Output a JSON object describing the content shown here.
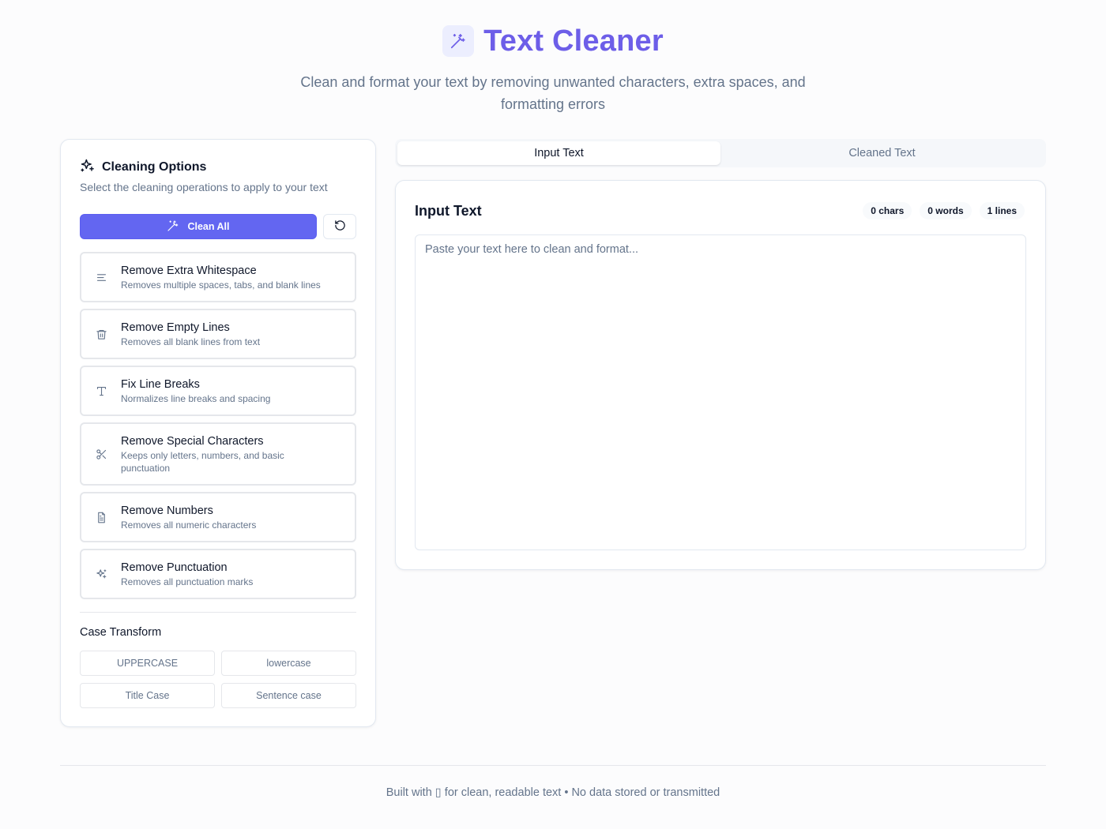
{
  "header": {
    "title": "Text Cleaner",
    "subtitle": "Clean and format your text by removing unwanted characters, extra spaces, and formatting errors",
    "logo_icon": "magic-wand-icon"
  },
  "options_panel": {
    "title": "Cleaning Options",
    "subtitle": "Select the cleaning operations to apply to your text",
    "clean_all_label": "Clean All",
    "reset_icon": "rotate-ccw-icon",
    "options": [
      {
        "name": "Remove Extra Whitespace",
        "desc": "Removes multiple spaces, tabs, and blank lines",
        "icon": "align-left-icon"
      },
      {
        "name": "Remove Empty Lines",
        "desc": "Removes all blank lines from text",
        "icon": "trash-icon"
      },
      {
        "name": "Fix Line Breaks",
        "desc": "Normalizes line breaks and spacing",
        "icon": "type-icon"
      },
      {
        "name": "Remove Special Characters",
        "desc": "Keeps only letters, numbers, and basic punctuation",
        "icon": "scissors-icon"
      },
      {
        "name": "Remove Numbers",
        "desc": "Removes all numeric characters",
        "icon": "file-text-icon"
      },
      {
        "name": "Remove Punctuation",
        "desc": "Removes all punctuation marks",
        "icon": "sparkles-icon"
      }
    ],
    "case_transform": {
      "title": "Case Transform",
      "buttons": [
        "UPPERCASE",
        "lowercase",
        "Title Case",
        "Sentence case"
      ]
    }
  },
  "tabs": [
    {
      "label": "Input Text",
      "active": true
    },
    {
      "label": "Cleaned Text",
      "active": false
    }
  ],
  "input_card": {
    "title": "Input Text",
    "stats": {
      "chars": "0 chars",
      "words": "0 words",
      "lines": "1 lines"
    },
    "placeholder": "Paste your text here to clean and format...",
    "value": ""
  },
  "footer": {
    "text": "Built with ▯ for clean, readable text • No data stored or transmitted"
  },
  "colors": {
    "accent": "#6366f1",
    "title": "#6d5ee8",
    "muted": "#64748b",
    "border": "#e2e8f0"
  }
}
